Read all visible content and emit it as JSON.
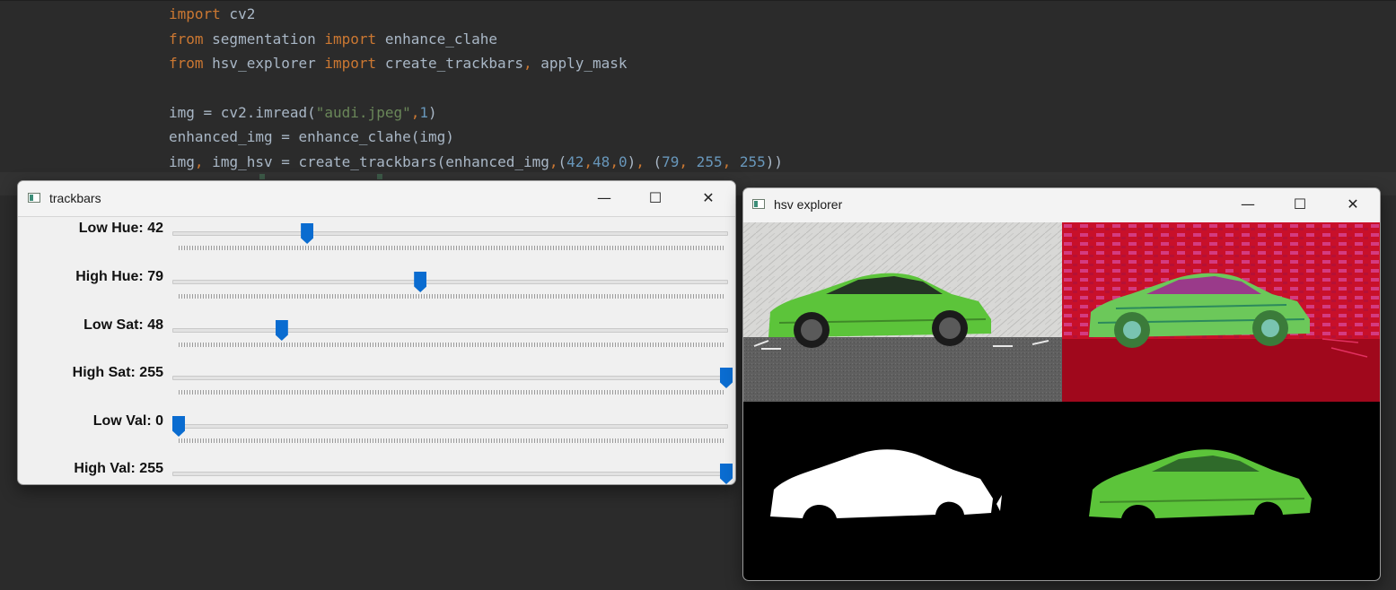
{
  "editor": {
    "line1": {
      "kw": "import",
      "rest": " cv2"
    },
    "line2": {
      "kw1": "from",
      "mod": " segmentation ",
      "kw2": "import",
      "rest": " enhance_clahe"
    },
    "line3": {
      "kw1": "from",
      "mod": " hsv_explorer ",
      "kw2": "import",
      "rest1": " create_trackbars",
      "comma": ",",
      "rest2": " apply_mask"
    },
    "line4": {
      "pre": "img = cv2.imread(",
      "str": "\"audi.jpeg\"",
      "comma": ",",
      "num": "1",
      "post": ")"
    },
    "line5": {
      "text": "enhanced_img = enhance_clahe(img)"
    },
    "line6": {
      "p1": "img",
      "c1": ",",
      "p2": " img_hsv = create_trackbars(enhanced_img",
      "c2": ",",
      "p3": "(",
      "n1": "42",
      "c3": ",",
      "n2": "48",
      "c4": ",",
      "n3": "0",
      "p4": ")",
      "c5": ",",
      "p5": " (",
      "n4": "79",
      "c6": ",",
      "n5": " 255",
      "c7": ",",
      "n6": " 255",
      "p6": "))"
    }
  },
  "trackbars_window": {
    "title": "trackbars",
    "icon": "opencv-window-icon",
    "controls": {
      "minimize": "—",
      "maximize": "☐",
      "close": "✕"
    },
    "trackbars": [
      {
        "label": "Low Hue: 42",
        "value": 42,
        "max": 179
      },
      {
        "label": "High Hue: 79",
        "value": 79,
        "max": 179
      },
      {
        "label": "Low Sat: 48",
        "value": 48,
        "max": 255
      },
      {
        "label": "High Sat: 255",
        "value": 255,
        "max": 255
      },
      {
        "label": "Low Val: 0",
        "value": 0,
        "max": 255
      },
      {
        "label": "High Val: 255",
        "value": 255,
        "max": 255
      }
    ]
  },
  "hsv_window": {
    "title": "hsv explorer",
    "icon": "opencv-window-icon",
    "controls": {
      "minimize": "—",
      "maximize": "☐",
      "close": "✕"
    },
    "panels": [
      "original-image",
      "hsv-image",
      "mask-image",
      "masked-result-image"
    ]
  },
  "colors": {
    "editor_bg": "#2b2b2b",
    "keyword": "#cc7832",
    "string": "#6a8759",
    "number": "#6897bb",
    "identifier": "#a9b7c6",
    "thumb": "#0a6cd0"
  }
}
